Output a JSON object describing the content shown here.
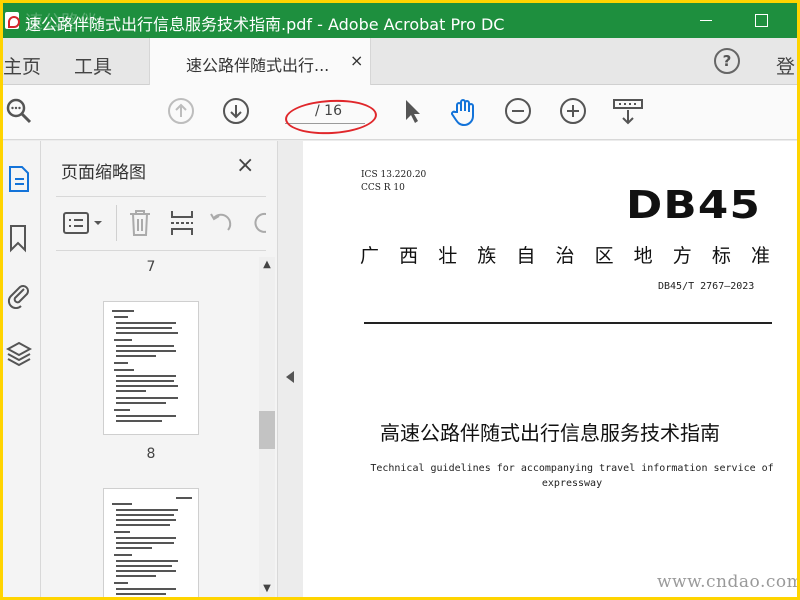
{
  "window": {
    "title": "速公路伴随式出行信息服务技术指南.pdf - Adobe Acrobat Pro DC",
    "watermark_top": "速公路伴"
  },
  "tabs": {
    "home": "主页",
    "tools": "工具",
    "document": "速公路伴随式出行...",
    "close_glyph": "×",
    "help_glyph": "?",
    "signin": "登"
  },
  "toolbar": {
    "current_page": "",
    "total_pages": "/ 16"
  },
  "panel": {
    "title": "页面缩略图",
    "close_glyph": "×",
    "pages": [
      "7",
      "8"
    ]
  },
  "document": {
    "ics": "ICS  13.220.20",
    "ccs": "CCS  R 10",
    "standard_code": "DB45",
    "region_chars": [
      "广",
      "西",
      "壮",
      "族",
      "自",
      "治",
      "区",
      "地",
      "方",
      "标",
      "准"
    ],
    "standard_number": "DB45/T 2767—2023",
    "title_cn": "高速公路伴随式出行信息服务技术指南",
    "title_en": "Technical guidelines for accompanying travel information service of expressway"
  },
  "watermark": "www.cndao.com",
  "colors": {
    "titlebar": "#1e8f3e",
    "border": "#ffd400",
    "annotation": "#e0272b"
  }
}
